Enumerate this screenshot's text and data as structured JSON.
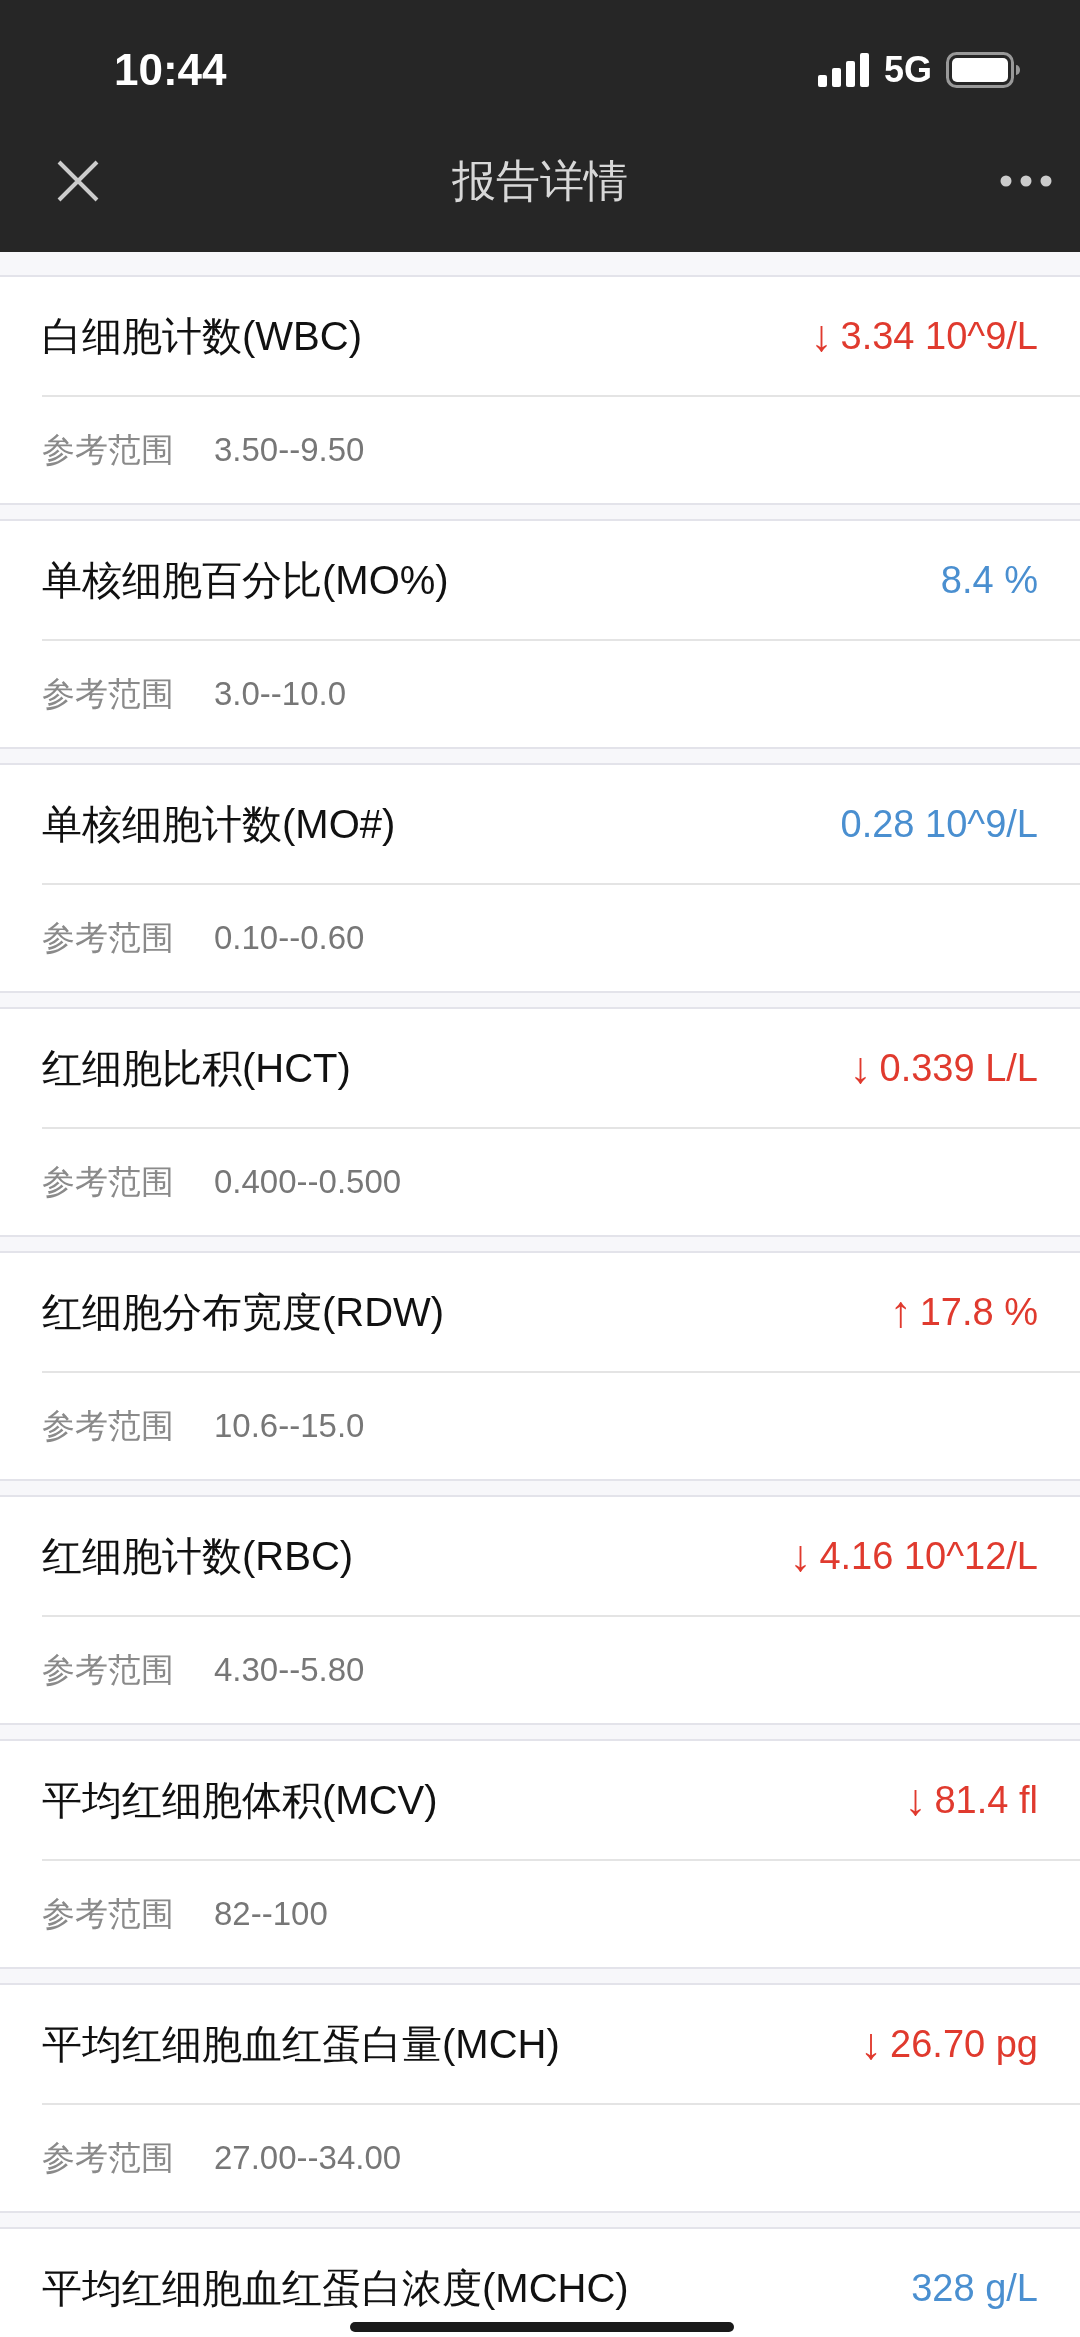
{
  "status_bar": {
    "time": "10:44",
    "network": "5G"
  },
  "nav_bar": {
    "title": "报告详情"
  },
  "results": [
    {
      "name": "白细胞计数(WBC)",
      "arrow": "↓",
      "value": "3.34 10^9/L",
      "abnormal": true,
      "range_label": "参考范围",
      "range": "3.50--9.50"
    },
    {
      "name": "单核细胞百分比(MO%)",
      "value": "8.4 %",
      "abnormal": false,
      "range_label": "参考范围",
      "range": "3.0--10.0"
    },
    {
      "name": "单核细胞计数(MO#)",
      "value": "0.28 10^9/L",
      "abnormal": false,
      "range_label": "参考范围",
      "range": "0.10--0.60"
    },
    {
      "name": "红细胞比积(HCT)",
      "arrow": "↓",
      "value": "0.339 L/L",
      "abnormal": true,
      "range_label": "参考范围",
      "range": "0.400--0.500"
    },
    {
      "name": "红细胞分布宽度(RDW)",
      "arrow": "↑",
      "value": "17.8 %",
      "abnormal": true,
      "range_label": "参考范围",
      "range": "10.6--15.0"
    },
    {
      "name": "红细胞计数(RBC)",
      "arrow": "↓",
      "value": "4.16 10^12/L",
      "abnormal": true,
      "range_label": "参考范围",
      "range": "4.30--5.80"
    },
    {
      "name": "平均红细胞体积(MCV)",
      "arrow": "↓",
      "value": "81.4 fl",
      "abnormal": true,
      "range_label": "参考范围",
      "range": "82--100"
    },
    {
      "name": "平均红细胞血红蛋白量(MCH)",
      "arrow": "↓",
      "value": "26.70 pg",
      "abnormal": true,
      "range_label": "参考范围",
      "range": "27.00--34.00"
    },
    {
      "name": "平均红细胞血红蛋白浓度(MCHC)",
      "value": "328 g/L",
      "abnormal": false
    }
  ]
}
